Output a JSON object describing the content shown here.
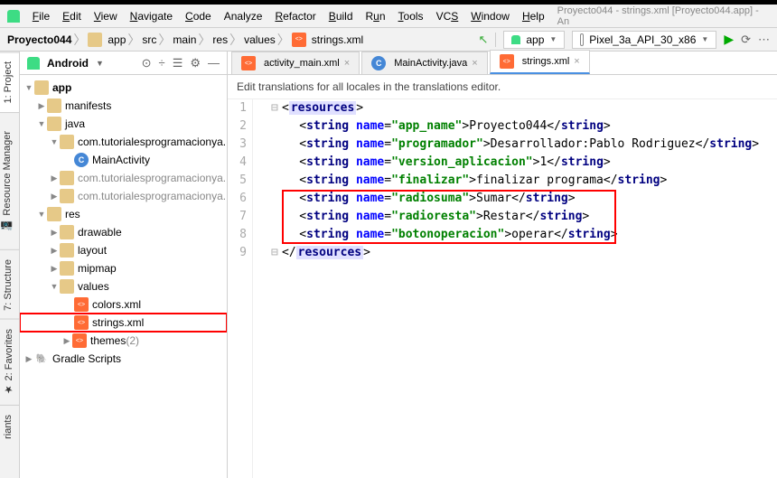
{
  "titlebar": "Proyecto044 - strings.xml [Proyecto044.app] - An",
  "menu": {
    "file": "File",
    "edit": "Edit",
    "view": "View",
    "navigate": "Navigate",
    "code": "Code",
    "analyze": "Analyze",
    "refactor": "Refactor",
    "build": "Build",
    "run": "Run",
    "tools": "Tools",
    "vcs": "VCS",
    "window": "Window",
    "help": "Help"
  },
  "breadcrumbs": [
    "Proyecto044",
    "app",
    "src",
    "main",
    "res",
    "values",
    "strings.xml"
  ],
  "run_config": "app",
  "device": "Pixel_3a_API_30_x86",
  "sidetabs": {
    "project": "1: Project",
    "resmgr": "Resource Manager",
    "structure": "7: Structure",
    "favorites": "2: Favorites",
    "variants": "riants"
  },
  "tree_header": "Android",
  "tree": {
    "root": "app",
    "manifests": "manifests",
    "java": "java",
    "pkg1": "com.tutorialesprogramacionya.",
    "activity": "MainActivity",
    "pkg2": "com.tutorialesprogramacionya.",
    "pkg3": "com.tutorialesprogramacionya.",
    "res": "res",
    "drawable": "drawable",
    "layout": "layout",
    "mipmap": "mipmap",
    "values": "values",
    "colors": "colors.xml",
    "strings": "strings.xml",
    "themes": "themes",
    "themes_count": "(2)",
    "gradle": "Gradle Scripts"
  },
  "editor_tabs": {
    "activity_main": "activity_main.xml",
    "main_activity": "MainActivity.java",
    "strings": "strings.xml"
  },
  "banner": "Edit translations for all locales in the translations editor.",
  "gutter_lines": [
    "1",
    "2",
    "3",
    "4",
    "5",
    "6",
    "7",
    "8",
    "9"
  ],
  "code": {
    "open_res": "resources",
    "string_tag": "string",
    "name_attr": "name",
    "close_string": "string",
    "close_res": "resources",
    "rows": [
      {
        "name": "app_name",
        "text": "Proyecto044"
      },
      {
        "name": "programador",
        "text": "Desarrollador:Pablo Rodriguez"
      },
      {
        "name": "version_aplicacion",
        "text": "1"
      },
      {
        "name": "finalizar",
        "text": "finalizar programa"
      },
      {
        "name": "radiosuma",
        "text": "Sumar"
      },
      {
        "name": "radioresta",
        "text": "Restar"
      },
      {
        "name": "botonoperacion",
        "text": "operar"
      }
    ]
  }
}
